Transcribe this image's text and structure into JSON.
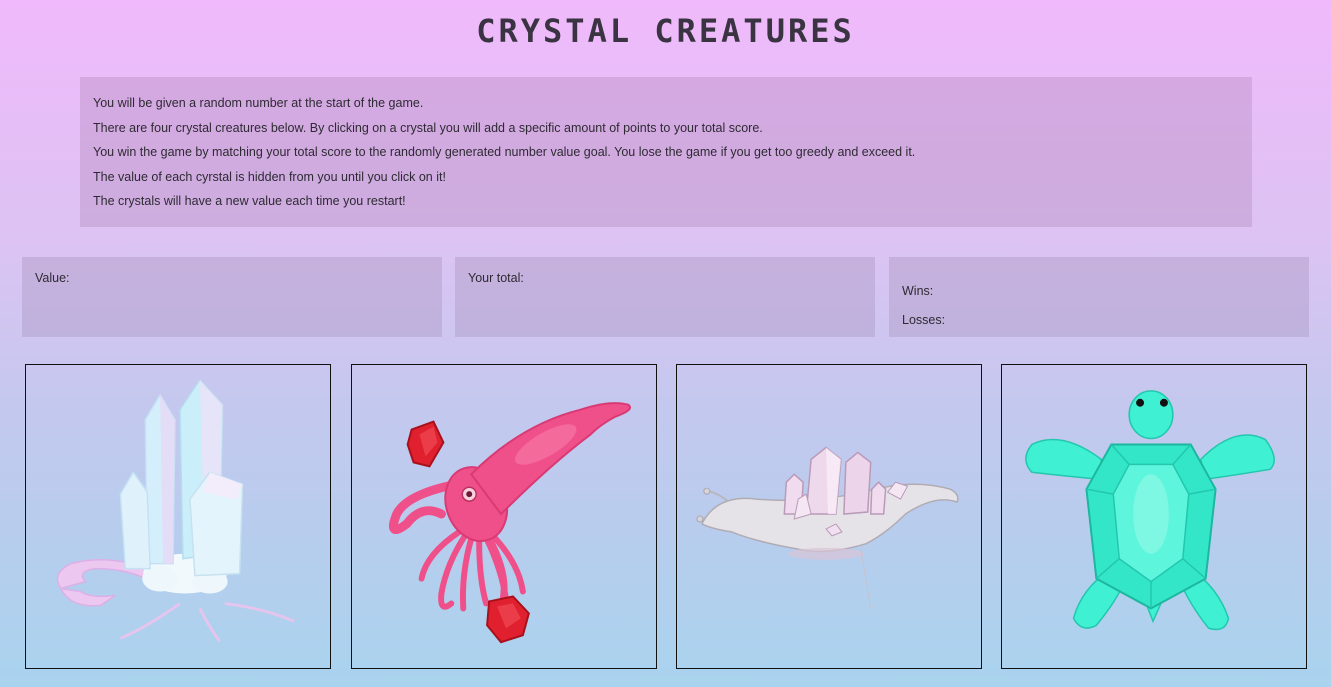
{
  "title": "CRYSTAL CREATURES",
  "instructions": [
    "You will be given a random number at the start of the game.",
    "There are four crystal creatures below. By clicking on a crystal you will add a specific amount of points to your total score.",
    "You win the game by matching your total score to the randomly generated number value goal. You lose the game if you get too greedy and exceed it.",
    "The value of each cyrstal is hidden from you until you click on it!",
    "The crystals will have a new value each time you restart!"
  ],
  "stats": {
    "value_label": "Value:",
    "total_label": "Your total:",
    "wins_label": "Wins:",
    "losses_label": "Losses:"
  },
  "crystals": [
    {
      "name": "crystal-crab",
      "icon": "crystal-crab-icon"
    },
    {
      "name": "ruby-squid",
      "icon": "ruby-squid-icon"
    },
    {
      "name": "quartz-slug",
      "icon": "quartz-slug-icon"
    },
    {
      "name": "emerald-turtle",
      "icon": "emerald-turtle-icon"
    }
  ],
  "colors": {
    "background_top": "#f0b9fb",
    "background_bottom": "#a9d3ee",
    "title": "#3a3342",
    "squid": "#f0508a",
    "ruby": "#e0202e",
    "turtle": "#3ff0d3",
    "crystal_white": "#dcf1fb"
  }
}
